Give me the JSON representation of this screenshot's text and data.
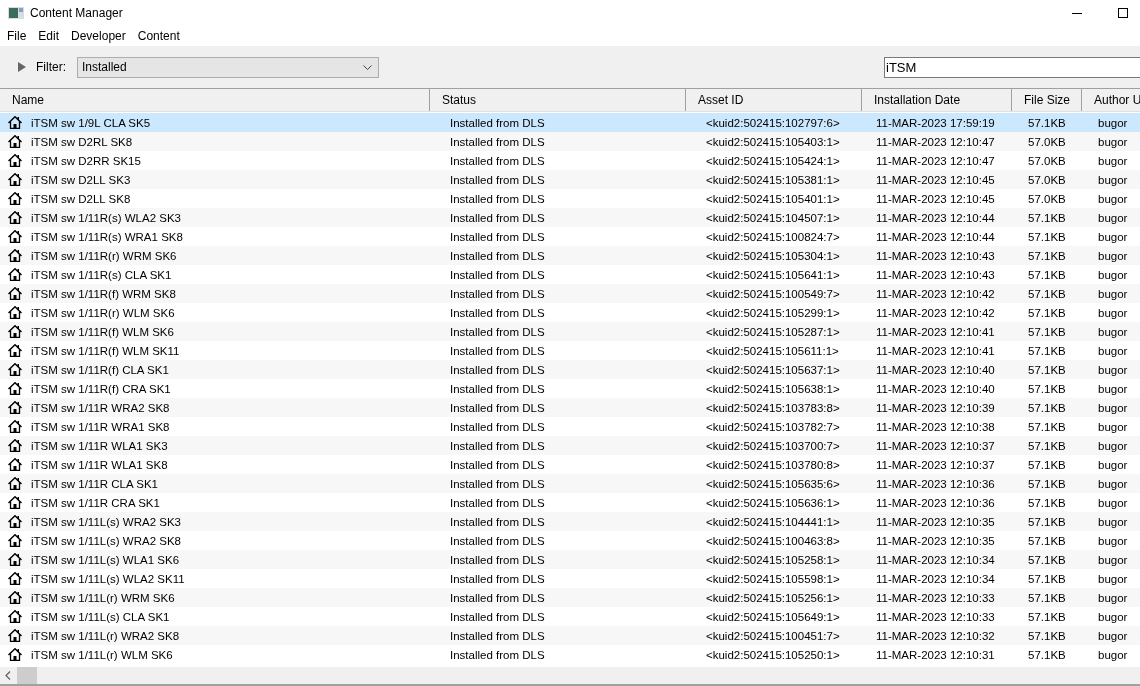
{
  "window": {
    "title": "Content Manager"
  },
  "menu": [
    "File",
    "Edit",
    "Developer",
    "Content"
  ],
  "filter": {
    "label": "Filter:",
    "value": "Installed",
    "expanded": false
  },
  "search": {
    "value": "iTSM"
  },
  "table": {
    "columns": [
      "Name",
      "Status",
      "Asset ID",
      "Installation Date",
      "File Size",
      "Author U"
    ],
    "rows": [
      {
        "selected": true,
        "cells": [
          "iTSM sw 1/9L CLA SK5",
          "Installed from DLS",
          "<kuid2:502415:102797:6>",
          "11-MAR-2023 17:59:19",
          "57.1KB",
          "bugor"
        ]
      },
      {
        "selected": false,
        "cells": [
          "iTSM sw D2RL SK8",
          "Installed from DLS",
          "<kuid2:502415:105403:1>",
          "11-MAR-2023 12:10:47",
          "57.0KB",
          "bugor"
        ]
      },
      {
        "selected": false,
        "cells": [
          "iTSM sw D2RR SK15",
          "Installed from DLS",
          "<kuid2:502415:105424:1>",
          "11-MAR-2023 12:10:47",
          "57.0KB",
          "bugor"
        ]
      },
      {
        "selected": false,
        "cells": [
          "iTSM sw D2LL SK3",
          "Installed from DLS",
          "<kuid2:502415:105381:1>",
          "11-MAR-2023 12:10:45",
          "57.0KB",
          "bugor"
        ]
      },
      {
        "selected": false,
        "cells": [
          "iTSM sw D2LL SK8",
          "Installed from DLS",
          "<kuid2:502415:105401:1>",
          "11-MAR-2023 12:10:45",
          "57.0KB",
          "bugor"
        ]
      },
      {
        "selected": false,
        "cells": [
          "iTSM sw 1/11R(s) WLA2 SK3",
          "Installed from DLS",
          "<kuid2:502415:104507:1>",
          "11-MAR-2023 12:10:44",
          "57.1KB",
          "bugor"
        ]
      },
      {
        "selected": false,
        "cells": [
          "iTSM sw 1/11R(s) WRA1 SK8",
          "Installed from DLS",
          "<kuid2:502415:100824:7>",
          "11-MAR-2023 12:10:44",
          "57.1KB",
          "bugor"
        ]
      },
      {
        "selected": false,
        "cells": [
          "iTSM sw 1/11R(r) WRM SK6",
          "Installed from DLS",
          "<kuid2:502415:105304:1>",
          "11-MAR-2023 12:10:43",
          "57.1KB",
          "bugor"
        ]
      },
      {
        "selected": false,
        "cells": [
          "iTSM sw 1/11R(s) CLA SK1",
          "Installed from DLS",
          "<kuid2:502415:105641:1>",
          "11-MAR-2023 12:10:43",
          "57.1KB",
          "bugor"
        ]
      },
      {
        "selected": false,
        "cells": [
          "iTSM sw 1/11R(f) WRM SK8",
          "Installed from DLS",
          "<kuid2:502415:100549:7>",
          "11-MAR-2023 12:10:42",
          "57.1KB",
          "bugor"
        ]
      },
      {
        "selected": false,
        "cells": [
          "iTSM sw 1/11R(r) WLM SK6",
          "Installed from DLS",
          "<kuid2:502415:105299:1>",
          "11-MAR-2023 12:10:42",
          "57.1KB",
          "bugor"
        ]
      },
      {
        "selected": false,
        "cells": [
          "iTSM sw 1/11R(f) WLM SK6",
          "Installed from DLS",
          "<kuid2:502415:105287:1>",
          "11-MAR-2023 12:10:41",
          "57.1KB",
          "bugor"
        ]
      },
      {
        "selected": false,
        "cells": [
          "iTSM sw 1/11R(f) WLM SK11",
          "Installed from DLS",
          "<kuid2:502415:105611:1>",
          "11-MAR-2023 12:10:41",
          "57.1KB",
          "bugor"
        ]
      },
      {
        "selected": false,
        "cells": [
          "iTSM sw 1/11R(f) CLA SK1",
          "Installed from DLS",
          "<kuid2:502415:105637:1>",
          "11-MAR-2023 12:10:40",
          "57.1KB",
          "bugor"
        ]
      },
      {
        "selected": false,
        "cells": [
          "iTSM sw 1/11R(f) CRA SK1",
          "Installed from DLS",
          "<kuid2:502415:105638:1>",
          "11-MAR-2023 12:10:40",
          "57.1KB",
          "bugor"
        ]
      },
      {
        "selected": false,
        "cells": [
          "iTSM sw 1/11R WRA2 SK8",
          "Installed from DLS",
          "<kuid2:502415:103783:8>",
          "11-MAR-2023 12:10:39",
          "57.1KB",
          "bugor"
        ]
      },
      {
        "selected": false,
        "cells": [
          "iTSM sw 1/11R WRA1 SK8",
          "Installed from DLS",
          "<kuid2:502415:103782:7>",
          "11-MAR-2023 12:10:38",
          "57.1KB",
          "bugor"
        ]
      },
      {
        "selected": false,
        "cells": [
          "iTSM sw 1/11R WLA1 SK3",
          "Installed from DLS",
          "<kuid2:502415:103700:7>",
          "11-MAR-2023 12:10:37",
          "57.1KB",
          "bugor"
        ]
      },
      {
        "selected": false,
        "cells": [
          "iTSM sw 1/11R WLA1 SK8",
          "Installed from DLS",
          "<kuid2:502415:103780:8>",
          "11-MAR-2023 12:10:37",
          "57.1KB",
          "bugor"
        ]
      },
      {
        "selected": false,
        "cells": [
          "iTSM sw 1/11R CLA SK1",
          "Installed from DLS",
          "<kuid2:502415:105635:6>",
          "11-MAR-2023 12:10:36",
          "57.1KB",
          "bugor"
        ]
      },
      {
        "selected": false,
        "cells": [
          "iTSM sw 1/11R CRA SK1",
          "Installed from DLS",
          "<kuid2:502415:105636:1>",
          "11-MAR-2023 12:10:36",
          "57.1KB",
          "bugor"
        ]
      },
      {
        "selected": false,
        "cells": [
          "iTSM sw 1/11L(s) WRA2 SK3",
          "Installed from DLS",
          "<kuid2:502415:104441:1>",
          "11-MAR-2023 12:10:35",
          "57.1KB",
          "bugor"
        ]
      },
      {
        "selected": false,
        "cells": [
          "iTSM sw 1/11L(s) WRA2 SK8",
          "Installed from DLS",
          "<kuid2:502415:100463:8>",
          "11-MAR-2023 12:10:35",
          "57.1KB",
          "bugor"
        ]
      },
      {
        "selected": false,
        "cells": [
          "iTSM sw 1/11L(s) WLA1 SK6",
          "Installed from DLS",
          "<kuid2:502415:105258:1>",
          "11-MAR-2023 12:10:34",
          "57.1KB",
          "bugor"
        ]
      },
      {
        "selected": false,
        "cells": [
          "iTSM sw 1/11L(s) WLA2 SK11",
          "Installed from DLS",
          "<kuid2:502415:105598:1>",
          "11-MAR-2023 12:10:34",
          "57.1KB",
          "bugor"
        ]
      },
      {
        "selected": false,
        "cells": [
          "iTSM sw 1/11L(r) WRM SK6",
          "Installed from DLS",
          "<kuid2:502415:105256:1>",
          "11-MAR-2023 12:10:33",
          "57.1KB",
          "bugor"
        ]
      },
      {
        "selected": false,
        "cells": [
          "iTSM sw 1/11L(s) CLA SK1",
          "Installed from DLS",
          "<kuid2:502415:105649:1>",
          "11-MAR-2023 12:10:33",
          "57.1KB",
          "bugor"
        ]
      },
      {
        "selected": false,
        "cells": [
          "iTSM sw 1/11L(r) WRA2 SK8",
          "Installed from DLS",
          "<kuid2:502415:100451:7>",
          "11-MAR-2023 12:10:32",
          "57.1KB",
          "bugor"
        ]
      },
      {
        "selected": false,
        "cells": [
          "iTSM sw 1/11L(r) WLM SK6",
          "Installed from DLS",
          "<kuid2:502415:105250:1>",
          "11-MAR-2023 12:10:31",
          "57.1KB",
          "bugor"
        ]
      }
    ]
  }
}
